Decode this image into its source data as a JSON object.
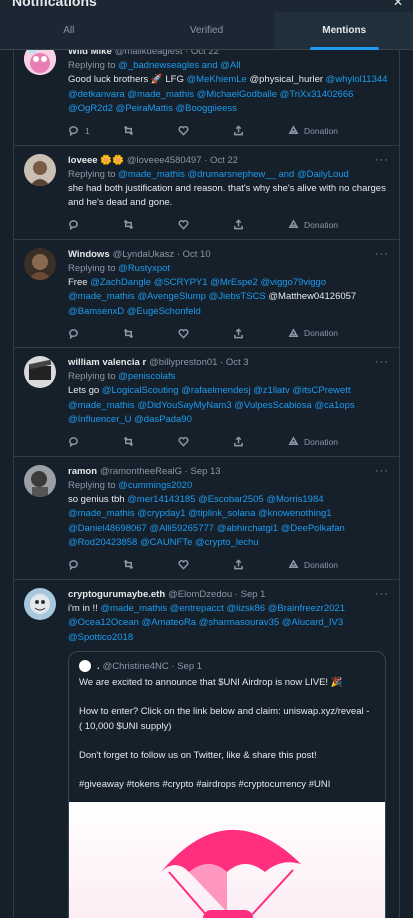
{
  "header": {
    "title": "Notifications",
    "close_icon": "close-icon"
  },
  "tabs": [
    {
      "label": "All",
      "active": false
    },
    {
      "label": "Verified",
      "active": false
    },
    {
      "label": "Mentions",
      "active": true
    }
  ],
  "colors": {
    "accent": "#1d9bf0",
    "background": "#15202b",
    "muted": "#8b98a5"
  },
  "tweets": [
    {
      "name": "Wild Mike",
      "handle": "@malikdeaglest · Oct 22",
      "replying_prefix": "Replying to",
      "replying_to": "@_badnewseagles and @All",
      "body": [
        {
          "t": "Good luck brothers 🚀 LFG ",
          "m": false
        },
        {
          "t": "@MeKhiemLe",
          "m": true
        },
        {
          "t": " @physical_hurler ",
          "m": false
        },
        {
          "t": "@whylol11344",
          "m": true
        },
        {
          "t": " ",
          "m": false
        },
        {
          "t": "@detkanvara",
          "m": true
        },
        {
          "t": " ",
          "m": false
        },
        {
          "t": "@made_mathis",
          "m": true
        },
        {
          "t": " ",
          "m": false
        },
        {
          "t": "@MichaelGodballe",
          "m": true
        },
        {
          "t": " ",
          "m": false
        },
        {
          "t": "@TriXx31402666",
          "m": true
        },
        {
          "t": " ",
          "m": false
        },
        {
          "t": "@OgR2d2",
          "m": true
        },
        {
          "t": " ",
          "m": false
        },
        {
          "t": "@PeiraMattis",
          "m": true
        },
        {
          "t": " ",
          "m": false
        },
        {
          "t": "@Booggiieess",
          "m": true
        }
      ],
      "actions": {
        "reply": "1",
        "retweet": "",
        "like": "",
        "share": "",
        "donation": "Donation"
      }
    },
    {
      "name": "loveee 🌼🌼",
      "handle": "@loveee4580497 · Oct 22",
      "replying_prefix": "Replying to",
      "replying_to": "@made_mathis @drumarsnephew__ and @DailyLoud",
      "body": [
        {
          "t": "she had both justification and reason. that's why she's alive with no charges and he's dead and gone.",
          "m": false
        }
      ],
      "actions": {
        "reply": "",
        "retweet": "",
        "like": "",
        "share": "",
        "donation": "Donation"
      }
    },
    {
      "name": "Windows",
      "handle": "@LyndaUkasz · Oct 10",
      "replying_prefix": "Replying to",
      "replying_to": "@Rustyxpot",
      "body": [
        {
          "t": "Free ",
          "m": false
        },
        {
          "t": "@ZachDangle",
          "m": true
        },
        {
          "t": " ",
          "m": false
        },
        {
          "t": "@SCRYPY1",
          "m": true
        },
        {
          "t": " ",
          "m": false
        },
        {
          "t": "@MrEspe2",
          "m": true
        },
        {
          "t": " ",
          "m": false
        },
        {
          "t": "@viggo79viggo",
          "m": true
        },
        {
          "t": " ",
          "m": false
        },
        {
          "t": "@made_mathis",
          "m": true
        },
        {
          "t": " ",
          "m": false
        },
        {
          "t": "@AvengeSlump",
          "m": true
        },
        {
          "t": " ",
          "m": false
        },
        {
          "t": "@JiebsTSCS",
          "m": true
        },
        {
          "t": " @Matthew04126057 ",
          "m": false
        },
        {
          "t": "@BamsenxD",
          "m": true
        },
        {
          "t": " ",
          "m": false
        },
        {
          "t": "@EugeSchonfeld",
          "m": true
        }
      ],
      "actions": {
        "reply": "",
        "retweet": "",
        "like": "",
        "share": "",
        "donation": "Donation"
      }
    },
    {
      "name": "william valencia r",
      "handle": "@billypreston01 · Oct 3",
      "replying_prefix": "Replying to",
      "replying_to": "@peniscolafs",
      "body": [
        {
          "t": "Lets go  ",
          "m": false
        },
        {
          "t": "@LogicalScouting",
          "m": true
        },
        {
          "t": " ",
          "m": false
        },
        {
          "t": "@rafaelmendesj",
          "m": true
        },
        {
          "t": " ",
          "m": false
        },
        {
          "t": "@z1llatv",
          "m": true
        },
        {
          "t": " ",
          "m": false
        },
        {
          "t": "@itsCPrewett",
          "m": true
        },
        {
          "t": " ",
          "m": false
        },
        {
          "t": "@made_mathis",
          "m": true
        },
        {
          "t": " ",
          "m": false
        },
        {
          "t": "@DidYouSayMyNam3",
          "m": true
        },
        {
          "t": " ",
          "m": false
        },
        {
          "t": "@VulpesScabiosa",
          "m": true
        },
        {
          "t": " ",
          "m": false
        },
        {
          "t": "@ca1ops",
          "m": true
        },
        {
          "t": " ",
          "m": false
        },
        {
          "t": "@Influencer_U",
          "m": true
        },
        {
          "t": " ",
          "m": false
        },
        {
          "t": "@dasPada90",
          "m": true
        }
      ],
      "actions": {
        "reply": "",
        "retweet": "",
        "like": "",
        "share": "",
        "donation": "Donation"
      }
    },
    {
      "name": "ramon",
      "handle": "@ramontheeRealG · Sep 13",
      "replying_prefix": "Replying to",
      "replying_to": "@cummings2020",
      "body": [
        {
          "t": "so genius tbh ",
          "m": false
        },
        {
          "t": "@mer14143185",
          "m": true
        },
        {
          "t": " ",
          "m": false
        },
        {
          "t": "@Escobar2505",
          "m": true
        },
        {
          "t": " ",
          "m": false
        },
        {
          "t": "@Morris1984",
          "m": true
        },
        {
          "t": " ",
          "m": false
        },
        {
          "t": "@made_mathis",
          "m": true
        },
        {
          "t": " ",
          "m": false
        },
        {
          "t": "@crypday1",
          "m": true
        },
        {
          "t": " ",
          "m": false
        },
        {
          "t": "@tiplink_solana",
          "m": true
        },
        {
          "t": " ",
          "m": false
        },
        {
          "t": "@knowenothing1",
          "m": true
        },
        {
          "t": " ",
          "m": false
        },
        {
          "t": "@Daniel48698067",
          "m": true
        },
        {
          "t": " ",
          "m": false
        },
        {
          "t": "@Alli59265777",
          "m": true
        },
        {
          "t": " ",
          "m": false
        },
        {
          "t": "@abhirchatgi1",
          "m": true
        },
        {
          "t": " ",
          "m": false
        },
        {
          "t": "@DeePolkafan",
          "m": true
        },
        {
          "t": " ",
          "m": false
        },
        {
          "t": "@Rod20423858",
          "m": true
        },
        {
          "t": " ",
          "m": false
        },
        {
          "t": "@CAUNFTe",
          "m": true
        },
        {
          "t": " ",
          "m": false
        },
        {
          "t": "@crypto_lechu",
          "m": true
        }
      ],
      "actions": {
        "reply": "",
        "retweet": "",
        "like": "",
        "share": "",
        "donation": "Donation"
      }
    },
    {
      "name": "cryptogurumaybe.eth",
      "handle": "@ElomDzedou · Sep 1",
      "replying_prefix": "",
      "replying_to": "",
      "body": [
        {
          "t": "i'm in !! ",
          "m": false
        },
        {
          "t": "@made_mathis",
          "m": true
        },
        {
          "t": " ",
          "m": false
        },
        {
          "t": "@entrepacct",
          "m": true
        },
        {
          "t": " ",
          "m": false
        },
        {
          "t": "@lizsk86",
          "m": true
        },
        {
          "t": " ",
          "m": false
        },
        {
          "t": "@Brainfreezr2021",
          "m": true
        },
        {
          "t": " ",
          "m": false
        },
        {
          "t": "@Ocea12Ocean",
          "m": true
        },
        {
          "t": " ",
          "m": false
        },
        {
          "t": "@AmateoRa",
          "m": true
        },
        {
          "t": " ",
          "m": false
        },
        {
          "t": "@sharmasourav35",
          "m": true
        },
        {
          "t": " ",
          "m": false
        },
        {
          "t": "@Alucard_IV3",
          "m": true
        },
        {
          "t": " ",
          "m": false
        },
        {
          "t": "@Spottico2018",
          "m": true
        }
      ],
      "quote": {
        "name": ".",
        "handle": "@Christine4NC · Sep 1",
        "paragraphs": [
          "We are excited to announce that $UNI Airdrop is now LIVE! 🎉",
          "How to enter? Click on the link below and claim: uniswap.xyz/reveal - ( 10,000 $UNI supply)",
          "Don't forget to follow us on Twitter, like & share this post!",
          "#giveaway #tokens #crypto #airdrops #cryptocurrency #UNI"
        ]
      },
      "actions": null
    }
  ]
}
